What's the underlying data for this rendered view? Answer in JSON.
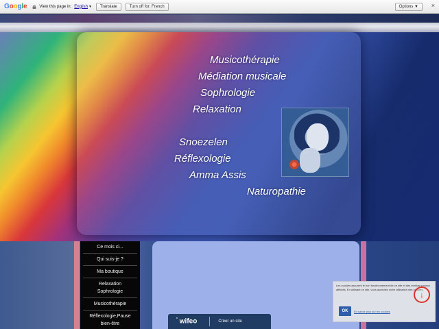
{
  "translate_bar": {
    "logo_letters": [
      "G",
      "o",
      "o",
      "g",
      "l",
      "e"
    ],
    "view_text": "View this page in:",
    "language": "English",
    "translate_button": "Translate",
    "turn_off_button": "Turn off for: French",
    "options": "Options ▼",
    "close": "×"
  },
  "hero": {
    "menu": [
      {
        "label": "Musicothérapie"
      },
      {
        "label": "Médiation musicale"
      },
      {
        "label": "Sophrologie"
      },
      {
        "label": "Relaxation"
      },
      {
        "label": "Snoezelen"
      },
      {
        "label": "Réflexologie"
      },
      {
        "label": "Amma Assis"
      },
      {
        "label": "Naturopathie"
      }
    ]
  },
  "nav": {
    "items": [
      {
        "label": "Ce mois ci..."
      },
      {
        "label": "Qui suis-je ?"
      },
      {
        "label": "Ma boutique"
      },
      {
        "label": "Relaxation"
      },
      {
        "label": "Sophrologie"
      },
      {
        "label": "Musicothérapie"
      },
      {
        "label": "Réflexologie,Pause"
      },
      {
        "label": "bien-être"
      }
    ]
  },
  "wifeo": {
    "logo": "wifeo",
    "create_site": "Créer un site"
  },
  "cookie": {
    "text": "Les cookies assurent le bon fonctionnement de ce site et des médias sociaux affichés. En utilisant ce site, vous acceptez notre utilisation des cookies.",
    "ok": "OK",
    "more": "En savoir plus sur les cookies"
  },
  "colors": {
    "nav_bg": "#070707",
    "content_bg": "#9db0ea",
    "wifeo_bg": "#203c63",
    "cookie_ok": "#2f5fa8",
    "cookie_arrow": "#e0322a"
  }
}
